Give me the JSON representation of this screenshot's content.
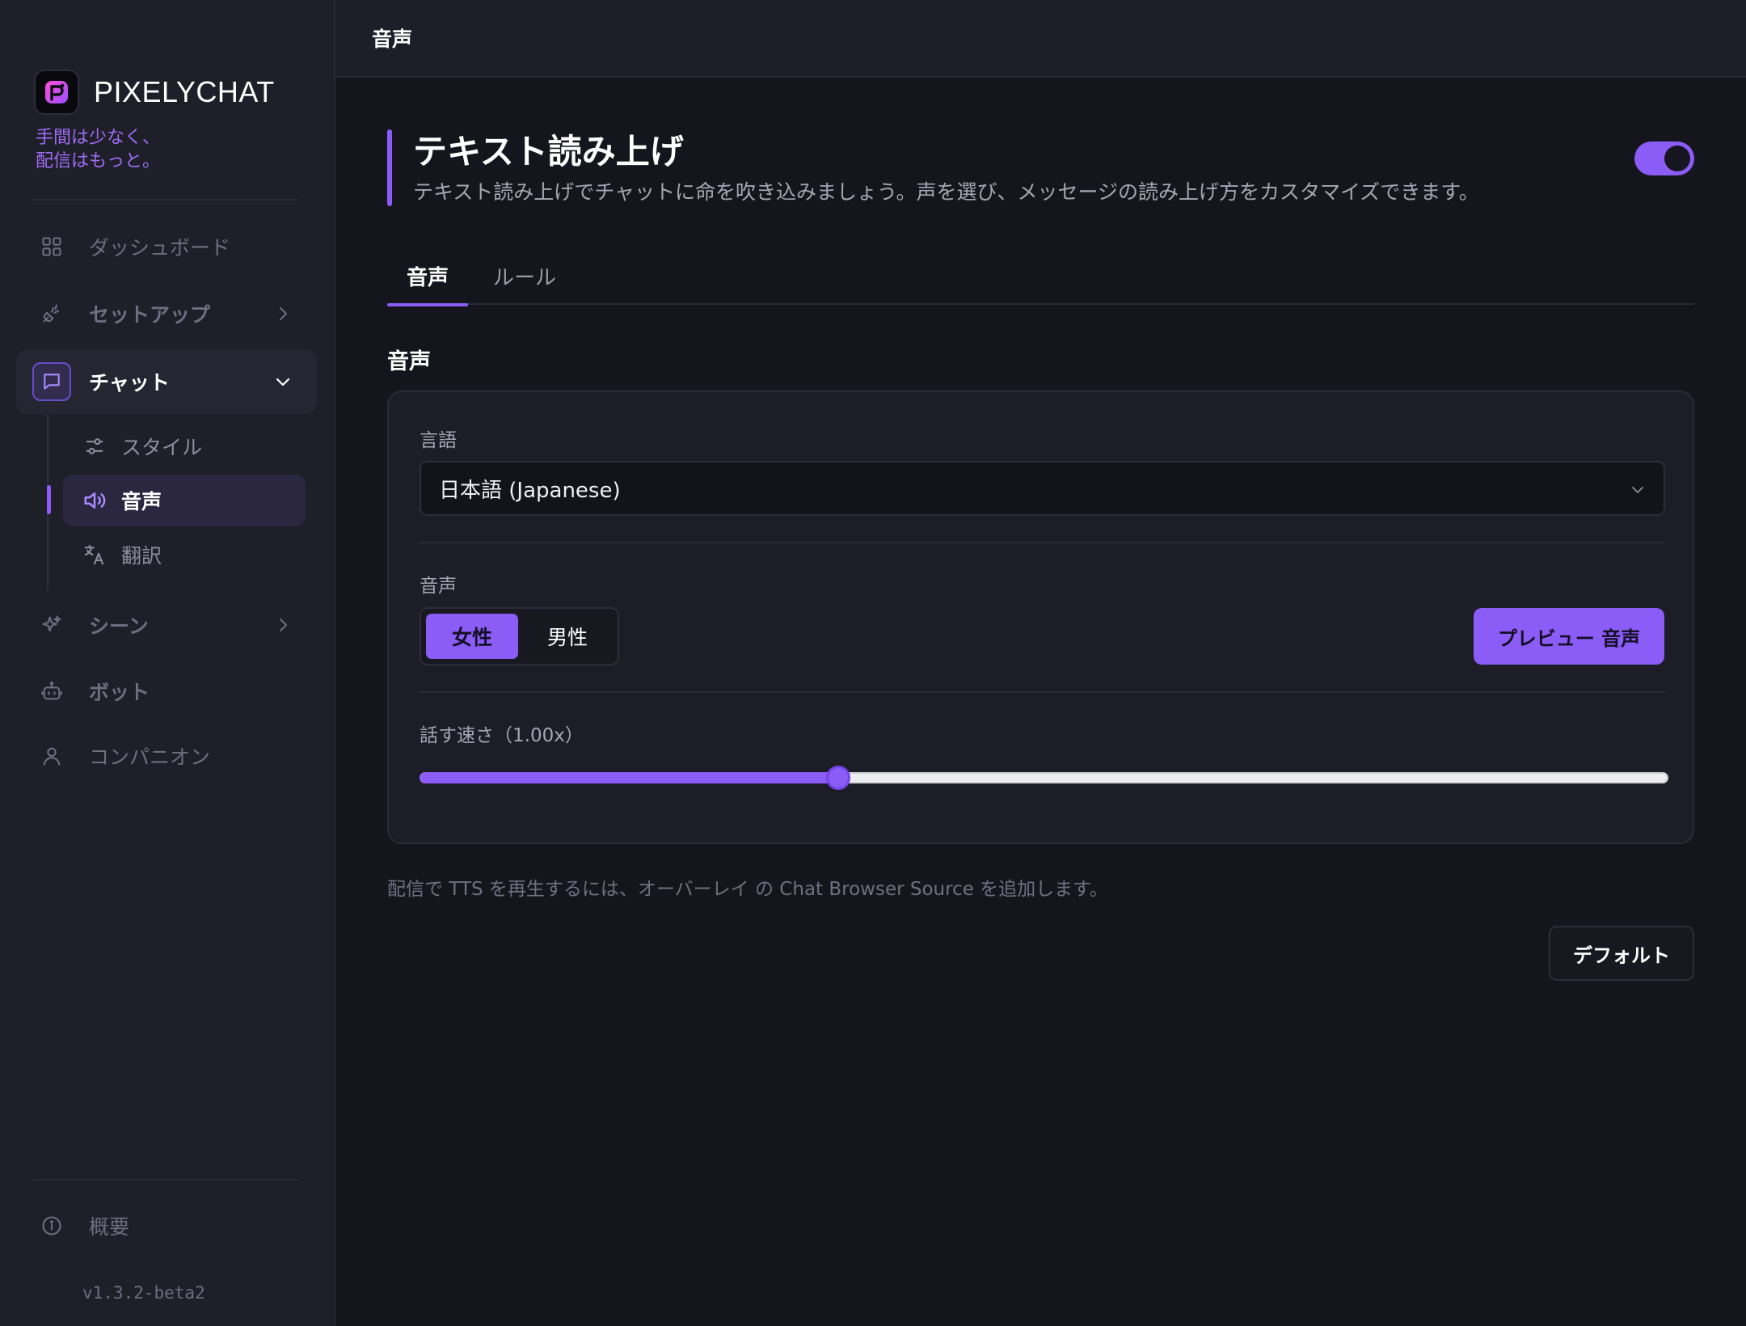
{
  "sidebar": {
    "brand_name": "PIXELYCHAT",
    "tagline": "手間は少なく、\n配信はもっと。",
    "nav": {
      "dashboard": "ダッシュボード",
      "setup": "セットアップ",
      "chat": "チャット",
      "scene": "シーン",
      "bot": "ボット",
      "companion": "コンパニオン",
      "about": "概要"
    },
    "chat_sub": {
      "style": "スタイル",
      "voice": "音声",
      "translate": "翻訳"
    },
    "version": "v1.3.2-beta2"
  },
  "topbar": {
    "title": "音声"
  },
  "header": {
    "title": "テキスト読み上げ",
    "description": "テキスト読み上げでチャットに命を吹き込みましょう。声を選び、メッセージの読み上げ方をカスタマイズできます。",
    "enabled": true
  },
  "tabs": {
    "voice": "音声",
    "rules": "ルール",
    "active": "音声"
  },
  "section": {
    "title": "音声",
    "language_label": "言語",
    "language_value": "日本語 (Japanese)",
    "voice_label": "音声",
    "voice_female": "女性",
    "voice_male": "男性",
    "voice_selected": "女性",
    "preview_button": "プレビュー 音声",
    "speed_label": "話す速さ（1.00x）",
    "speed_fraction": 0.335
  },
  "hint": "配信で TTS を再生するには、オーバーレイ の Chat Browser Source を追加します。",
  "default_button": "デフォルト",
  "colors": {
    "accent": "#8b5cf6",
    "background": "#15161d",
    "sidebar": "#1f1f2a"
  },
  "icons": [
    "pixelychat-logo-icon",
    "grid-icon",
    "plug-icon",
    "chat-icon",
    "sliders-icon",
    "speaker-icon",
    "translate-icon",
    "sparkles-icon",
    "bot-icon",
    "user-icon",
    "info-icon",
    "chevron-right-icon",
    "chevron-down-icon"
  ]
}
